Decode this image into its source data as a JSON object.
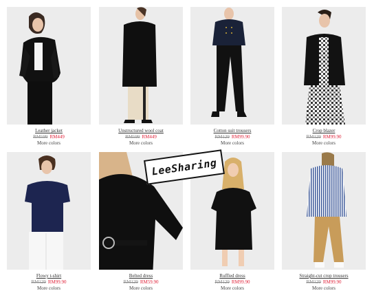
{
  "products": [
    {
      "name": "Leather jacket",
      "old_price": "RM599",
      "price": "RM449",
      "more": "More colors"
    },
    {
      "name": "Unstructured wool coat",
      "old_price": "RM599",
      "price": "RM449",
      "more": "More colors"
    },
    {
      "name": "Cotton suit trousers",
      "old_price": "RM129",
      "price": "RM99.90",
      "more": "More colors"
    },
    {
      "name": "Crop blazer",
      "old_price": "RM129",
      "price": "RM99.90",
      "more": "More colors"
    },
    {
      "name": "Flowy t-shirt",
      "old_price": "RM129",
      "price": "RM99.90",
      "more": "More colors"
    },
    {
      "name": "Belted dress",
      "old_price": "RM129",
      "price": "RM59.90",
      "more": "More colors"
    },
    {
      "name": "Ruffled dress",
      "old_price": "RM129",
      "price": "RM99.90",
      "more": "More colors"
    },
    {
      "name": "Straight-cut crop trousers",
      "old_price": "RM129",
      "price": "RM99.90",
      "more": "More colors"
    }
  ],
  "watermark": "LeeSharing"
}
